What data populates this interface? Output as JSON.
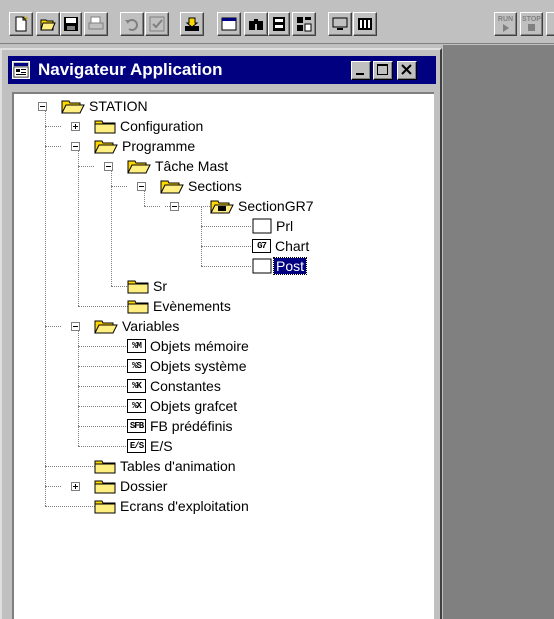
{
  "window": {
    "title": "Navigateur Application"
  },
  "toolbar": {
    "buttons": [
      {
        "icon": "new-document-icon"
      },
      {
        "icon": "open-folder-icon"
      },
      {
        "icon": "save-disk-icon"
      },
      {
        "icon": "print-icon"
      },
      {
        "icon": "undo-icon"
      },
      {
        "icon": "check-icon"
      },
      {
        "icon": "transfer-icon"
      },
      {
        "icon": "window-icon"
      },
      {
        "icon": "binoculars-icon"
      },
      {
        "icon": "module-icon"
      },
      {
        "icon": "tool-icon"
      },
      {
        "icon": "monitor-icon"
      },
      {
        "icon": "columns-icon"
      }
    ],
    "run_label": "RUN",
    "stop_label": "STOP"
  },
  "tree": {
    "station": "STATION",
    "configuration": "Configuration",
    "programme": "Programme",
    "tache_mast": "Tâche Mast",
    "sections": "Sections",
    "section_gr7": "SectionGR7",
    "prl": "Prl",
    "chart": "Chart",
    "chart_badge": "G7",
    "post": "Post",
    "sr": "Sr",
    "evenements": "Evènements",
    "variables": "Variables",
    "var_items": [
      {
        "badge": "%M",
        "label": "Objets mémoire"
      },
      {
        "badge": "%S",
        "label": "Objets système"
      },
      {
        "badge": "%K",
        "label": "Constantes"
      },
      {
        "badge": "%X",
        "label": "Objets grafcet"
      },
      {
        "badge": "SFB",
        "label": "FB prédéfinis"
      },
      {
        "badge": "E/S",
        "label": "E/S"
      }
    ],
    "tables_animation": "Tables d'animation",
    "dossier": "Dossier",
    "ecrans": "Ecrans d'exploitation"
  }
}
